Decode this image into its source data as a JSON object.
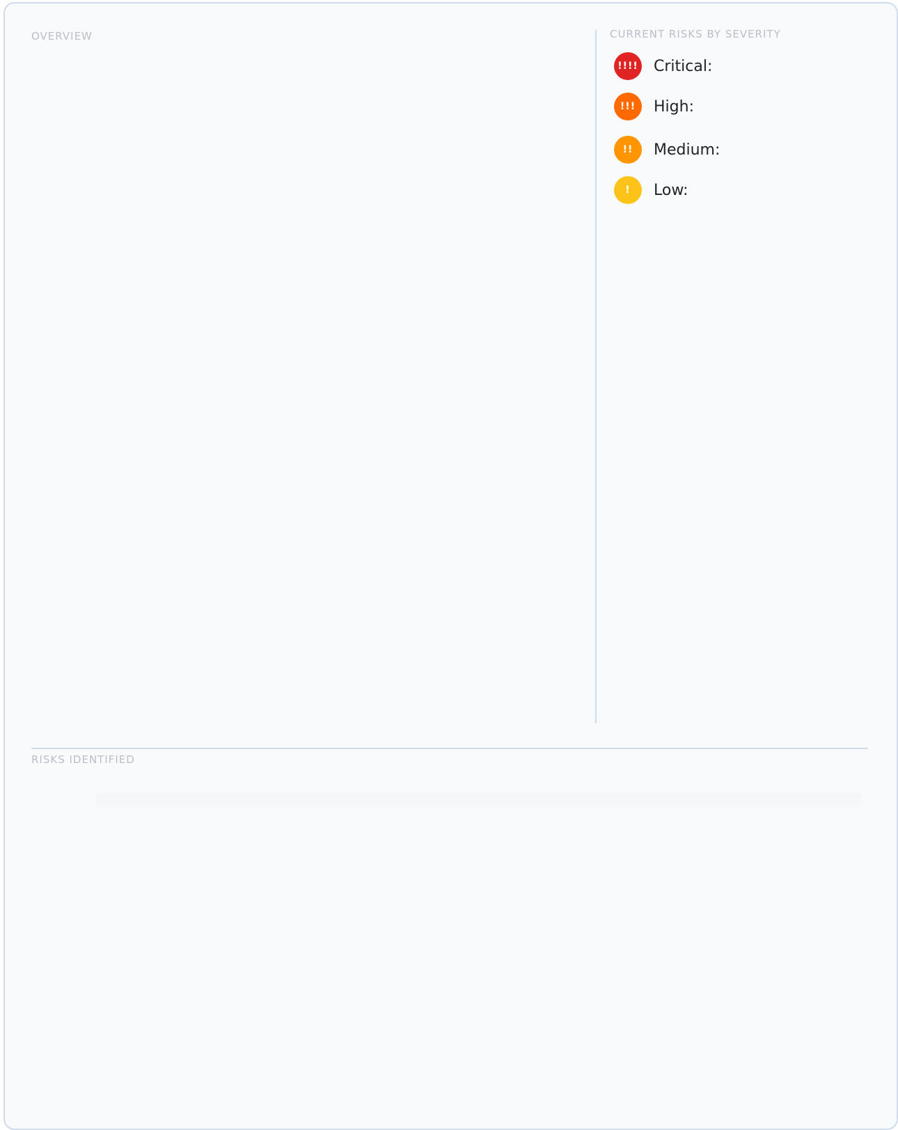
{
  "overview": {
    "label": "OVERVIEW"
  },
  "severity": {
    "label": "CURRENT RISKS BY SEVERITY",
    "items": [
      {
        "label": "Critical:",
        "glyph": "!!!!",
        "color": "#e02424",
        "icon": "critical-severity-icon"
      },
      {
        "label": "High:",
        "glyph": "!!!",
        "color": "#ff6a00",
        "icon": "high-severity-icon"
      },
      {
        "label": "Medium:",
        "glyph": "!!",
        "color": "#ff9500",
        "icon": "medium-severity-icon"
      },
      {
        "label": "Low:",
        "glyph": "!",
        "color": "#fcc419",
        "icon": "low-severity-icon"
      }
    ]
  },
  "risks": {
    "label": "RISKS IDENTIFIED"
  }
}
